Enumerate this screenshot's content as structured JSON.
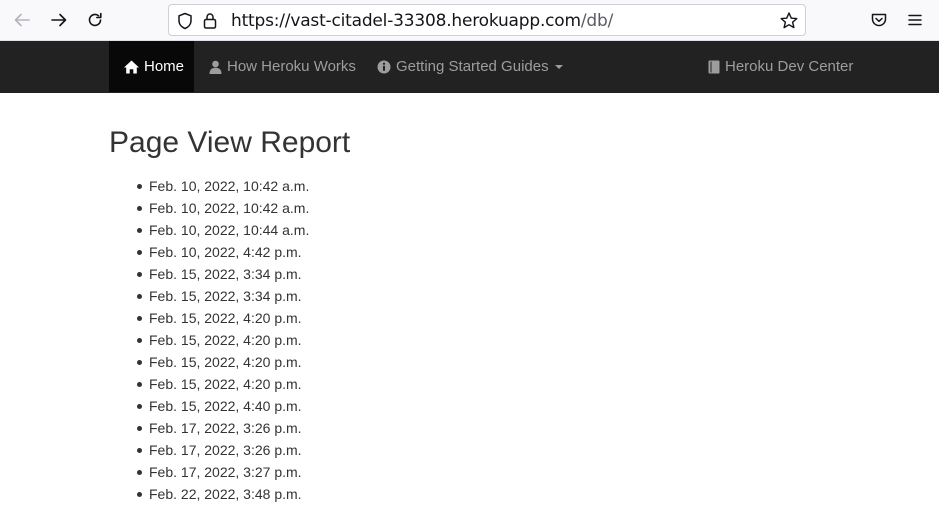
{
  "browser": {
    "url_main": "https://vast-citadel-33308.herokuapp.com",
    "url_path": "/db/",
    "icons": [
      "back-arrow-icon",
      "forward-arrow-icon",
      "reload-icon",
      "shield-icon",
      "lock-icon",
      "star-icon",
      "pocket-icon",
      "hamburger-menu-icon"
    ]
  },
  "navbar": {
    "home_label": "Home",
    "how_label": "How Heroku Works",
    "guides_label": "Getting Started Guides",
    "devcenter_label": "Heroku Dev Center",
    "background": "#222222",
    "active_background": "#080808"
  },
  "main": {
    "title": "Page View Report",
    "entries": [
      "Feb. 10, 2022, 10:42 a.m.",
      "Feb. 10, 2022, 10:42 a.m.",
      "Feb. 10, 2022, 10:44 a.m.",
      "Feb. 10, 2022, 4:42 p.m.",
      "Feb. 15, 2022, 3:34 p.m.",
      "Feb. 15, 2022, 3:34 p.m.",
      "Feb. 15, 2022, 4:20 p.m.",
      "Feb. 15, 2022, 4:20 p.m.",
      "Feb. 15, 2022, 4:20 p.m.",
      "Feb. 15, 2022, 4:20 p.m.",
      "Feb. 15, 2022, 4:40 p.m.",
      "Feb. 17, 2022, 3:26 p.m.",
      "Feb. 17, 2022, 3:26 p.m.",
      "Feb. 17, 2022, 3:27 p.m.",
      "Feb. 22, 2022, 3:48 p.m."
    ]
  }
}
